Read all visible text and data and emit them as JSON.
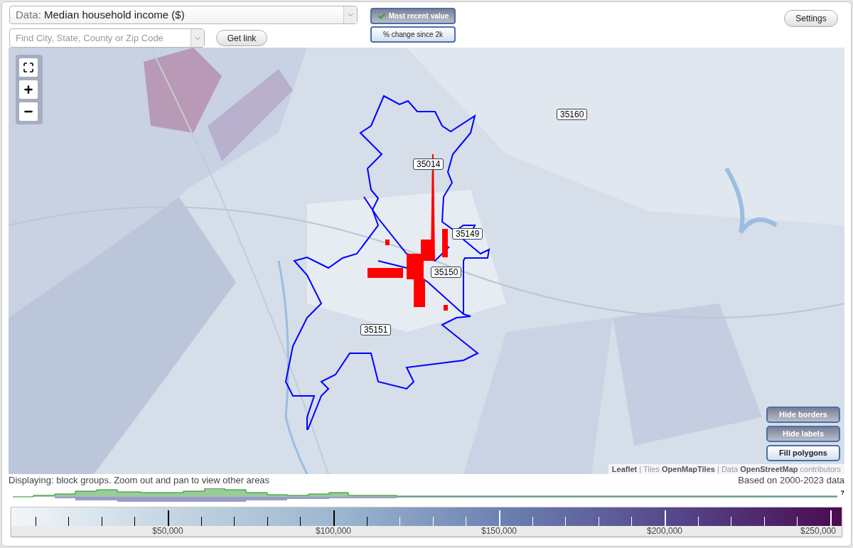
{
  "data_select": {
    "label": "Data:",
    "value": "Median household income ($)"
  },
  "search": {
    "placeholder": "Find City, State, County or Zip Code"
  },
  "get_link": "Get link",
  "view_toggle": [
    {
      "label": "Most recent value",
      "selected": true
    },
    {
      "label": "% change since 2k",
      "selected": false
    }
  ],
  "settings": "Settings",
  "map": {
    "zip_labels": [
      "35160",
      "35014",
      "35149",
      "35150",
      "35151"
    ],
    "layer_buttons": [
      {
        "label": "Hide borders",
        "on": true
      },
      {
        "label": "Hide labels",
        "on": true
      },
      {
        "label": "Fill polygons",
        "on": false
      }
    ],
    "attribution": "**Leaflet** | Tiles **OpenMapTiles** | Data **OpenStreetMap** contributors"
  },
  "status": "Displaying: block groups. Zoom out and pan to view other areas",
  "data_range": "Based on 2000-2023 data",
  "histogram": {
    "unknown_mark": "?"
  },
  "scale": {
    "labels": [
      "$50,000",
      "$100,000",
      "$150,000",
      "$200,000",
      "$250,000"
    ]
  }
}
